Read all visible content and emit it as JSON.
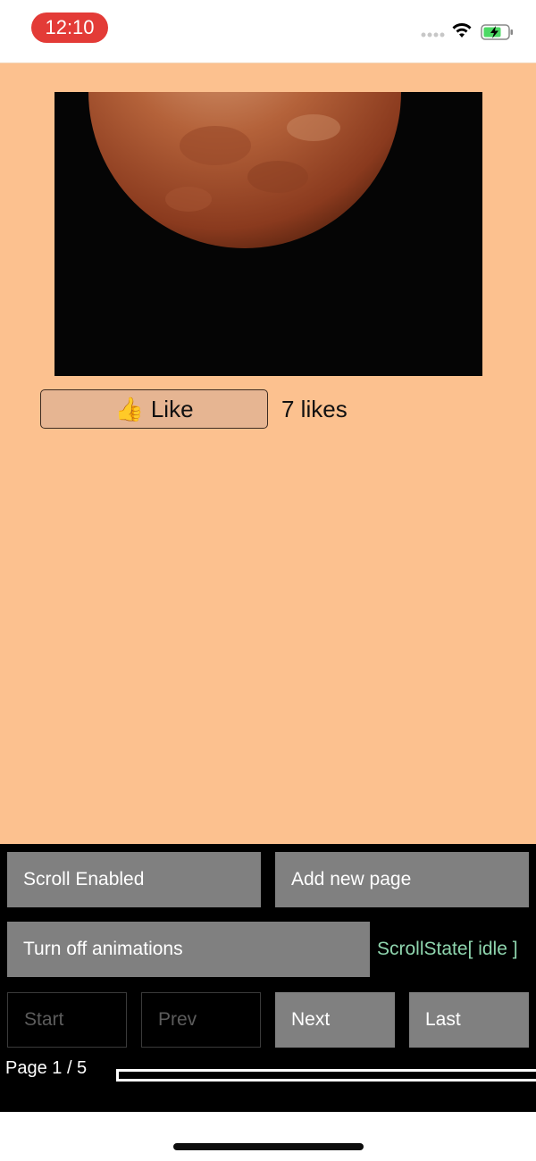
{
  "status_bar": {
    "time": "12:10",
    "icons": [
      "signal-dots-icon",
      "wifi-icon",
      "battery-charging-icon"
    ]
  },
  "post": {
    "image": "lunar-eclipse-red-moon",
    "like_button": {
      "emoji": "👍",
      "label": "Like"
    },
    "likes_text": "7 likes"
  },
  "controls": {
    "scroll_enabled": "Scroll Enabled",
    "add_new_page": "Add new page",
    "turn_off_animations": "Turn off animations",
    "scroll_state": "ScrollState[ idle ]",
    "start": "Start",
    "prev": "Prev",
    "next": "Next",
    "last": "Last",
    "page_indicator": "Page 1 / 5",
    "progress_fraction": 0
  },
  "colors": {
    "page_background": "#fcc18f",
    "time_pill": "#e33b37",
    "control_button": "#808080",
    "scroll_state_text": "#8fd5ae"
  }
}
